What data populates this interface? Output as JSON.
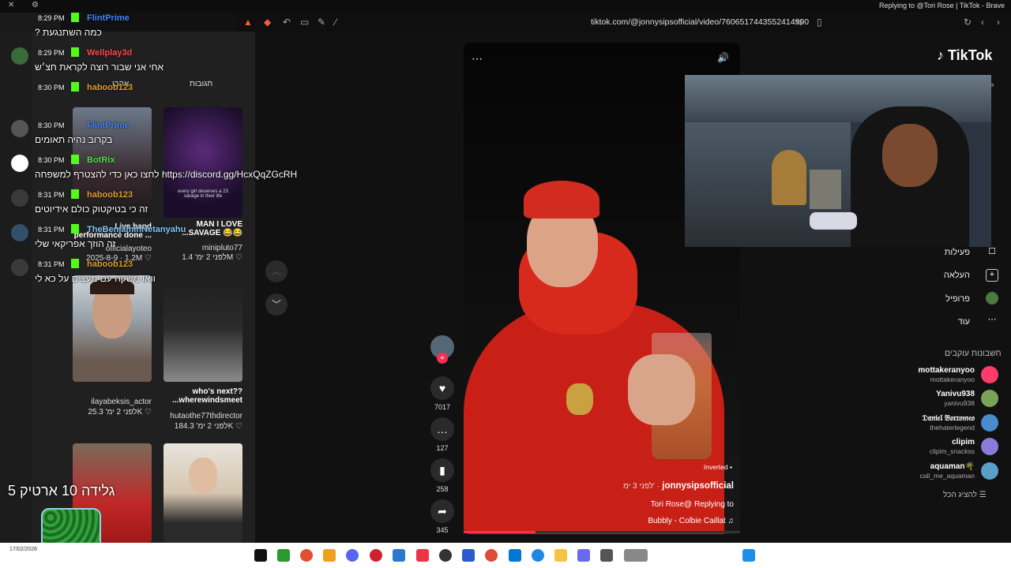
{
  "window": {
    "title": "Replying to @Tori Rose | TikTok - Brave",
    "url": "tiktok.com/@jonnysipsofficial/video/7606517443552414990"
  },
  "chat": {
    "messages": [
      {
        "time": "8:29 PM",
        "user": "FlintPrime",
        "user_color": "#3f86ff",
        "text": "? כמה השתנגעת"
      },
      {
        "time": "8:29 PM",
        "user": "Wellplay3d",
        "user_color": "#ff4a4a",
        "text": "אחי אני שבור רוצה לקראת חצ׳ש"
      },
      {
        "time": "8:30 PM",
        "user": "haboob123",
        "user_color": "#e09a2e",
        "text": ""
      },
      {
        "time": "8:30 PM",
        "user": "FlintPrime",
        "user_color": "#3f86ff",
        "text": "בקרוב נהיה תאומים"
      },
      {
        "time": "8:30 PM",
        "user": "BotRix",
        "user_color": "#4ee04e",
        "text": "לחצו כאן כדי להצטרף למשפחה https://discord.gg/HcxQqZGcRH"
      },
      {
        "time": "8:31 PM",
        "user": "haboob123",
        "user_color": "#e09a2e",
        "text": "זה כי בטיקטוק כולם אידיוטים"
      },
      {
        "time": "8:31 PM",
        "user": "TheBenjaminNetanyahu",
        "user_color": "#7cc5ff",
        "text": "זה הוזך אפריקאי שלי"
      },
      {
        "time": "8:31 PM",
        "user": "haboob123",
        "user_color": "#e09a2e",
        "text": "וואו משקה עם מעצים על כא לי"
      }
    ]
  },
  "left_panel": {
    "tabs": [
      "אהבו",
      "תגובות"
    ],
    "thumbs": [
      {
        "caption": "Live band performance done ...",
        "handle": "officialayoteo",
        "meta": "2025-8-9 · 1.2M ♡"
      },
      {
        "caption": "MAN I LOVE ...SAVAGE 😂😂",
        "handle": "minipluto77",
        "meta": "לפני 2 ימ' 1.4M ♡"
      },
      {
        "caption": "",
        "handle": "ilayabeksis_actor",
        "meta": "לפני 2 ימ' 25.3K ♡"
      },
      {
        "caption": "who's next?? ...wherewindsmeet",
        "handle": "hutaothe77thdirector",
        "meta": "לפני 2 ימ' 184.3K ♡"
      }
    ],
    "thumb_overlay_text": "every girl deserves a 23 savage in their life",
    "stream_overlay": "גלידה 10 ארטיק 5"
  },
  "video": {
    "author": "jonnysipsofficial",
    "posted": "לפני 3 ימ' ·",
    "caption": "Tori Rose@ Replying to",
    "music": "Bubbly - Colbie Caillat ♫",
    "badge": "Inverted",
    "likes": "7017",
    "comments": "127",
    "saves": "258",
    "shares": "345",
    "progress": 0.26
  },
  "tiktok_nav": {
    "logo": "TikTok",
    "items": [
      "פעילות",
      "העלאה",
      "פרופיל",
      "עוד"
    ],
    "following_header": "חשבונות עוקבים",
    "following": [
      {
        "name": "mottakeranyoo",
        "handle": "mottakeranyoo",
        "color": "#ff3b6b"
      },
      {
        "name": "Yanivu938",
        "handle": "yanivu938",
        "color": "#7aa35a"
      },
      {
        "name": "𝔇𝔞𝔫𝔦𝔢𝔩 𝔅𝔬𝔯𝔯𝔬𝔪𝔢𝔬",
        "handle": "thehaterlegend",
        "color": "#4a8acf"
      },
      {
        "name": "clipim",
        "handle": "clipim_snackss",
        "color": "#8b7bd8"
      },
      {
        "name": "aquaman🌴",
        "handle": "call_me_aquaman",
        "color": "#58a0c8"
      }
    ],
    "show_all": "להציג הכל"
  },
  "taskbar": {
    "date": "17/02/2026"
  },
  "colors": {
    "accent": "#fe2c55",
    "jacket": "#d8291d",
    "dark": "#111111"
  }
}
